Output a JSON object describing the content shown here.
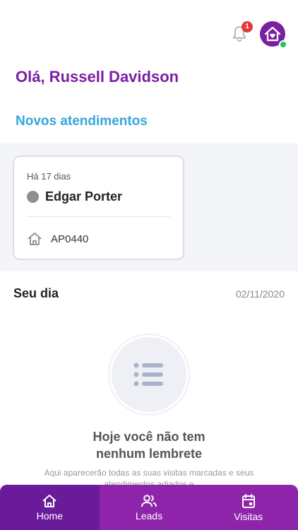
{
  "header": {
    "notification_count": "1",
    "online_status_color": "#21c46b"
  },
  "greeting": "Olá, Russell Davidson",
  "new_leads": {
    "title": "Novos atendimentos",
    "cards": [
      {
        "ago": "Há 17 dias",
        "name": "Edgar Porter",
        "property_code": "AP0440"
      }
    ]
  },
  "day": {
    "title": "Seu dia",
    "date": "02/11/2020",
    "empty_title_line1": "Hoje você não tem",
    "empty_title_line2": "nenhum lembrete",
    "empty_desc": "Aqui aparecerão todas as suas visitas marcadas e seus atendimentos adiados e"
  },
  "nav": {
    "items": [
      {
        "label": "Home",
        "icon": "home-icon",
        "active": true
      },
      {
        "label": "Leads",
        "icon": "people-icon",
        "active": false
      },
      {
        "label": "Visitas",
        "icon": "calendar-icon",
        "active": false
      }
    ]
  },
  "colors": {
    "brand_purple": "#7b1fa2",
    "nav_purple": "#8e24aa",
    "nav_active": "#6a1b9a",
    "accent_blue": "#34a7dc",
    "badge_red": "#e53935"
  }
}
